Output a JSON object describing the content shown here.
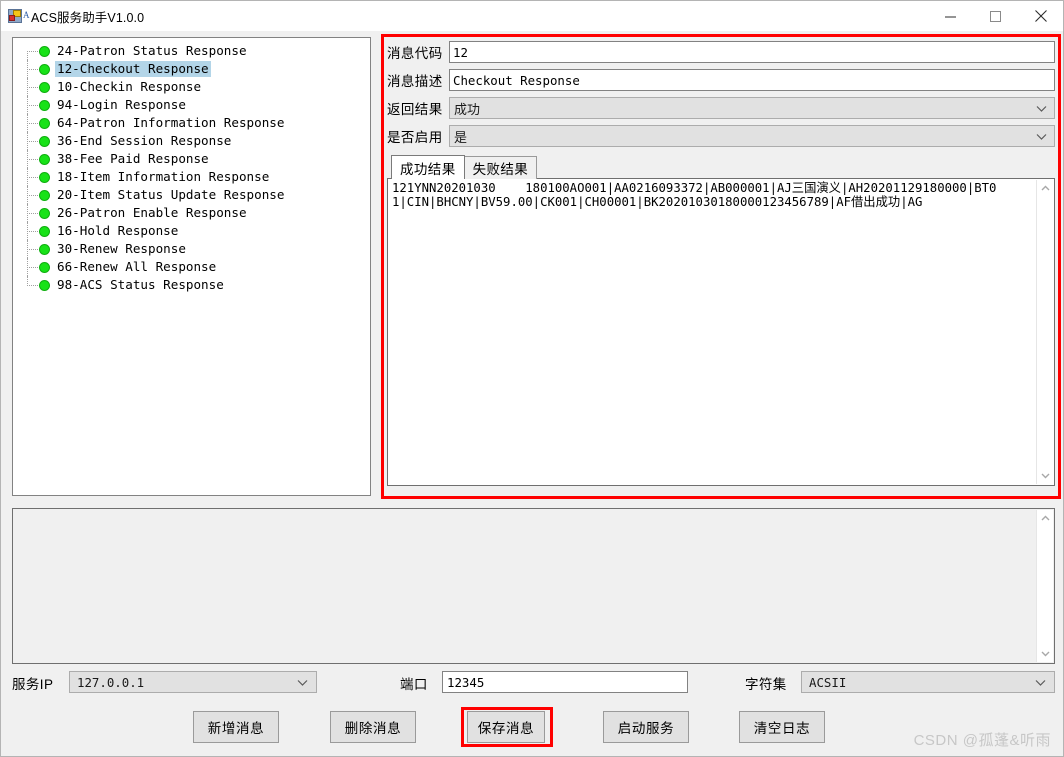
{
  "window": {
    "title": "ACS服务助手V1.0.0",
    "icon": "app-window-icon",
    "minimize": "−",
    "maximize": "□",
    "close": "✕"
  },
  "tree": {
    "items": [
      {
        "label": "24-Patron Status Response",
        "selected": false
      },
      {
        "label": "12-Checkout Response",
        "selected": true
      },
      {
        "label": "10-Checkin Response",
        "selected": false
      },
      {
        "label": "94-Login Response",
        "selected": false
      },
      {
        "label": "64-Patron Information Response",
        "selected": false
      },
      {
        "label": "36-End Session Response",
        "selected": false
      },
      {
        "label": "38-Fee Paid Response",
        "selected": false
      },
      {
        "label": "18-Item Information Response",
        "selected": false
      },
      {
        "label": "20-Item Status Update Response",
        "selected": false
      },
      {
        "label": "26-Patron Enable Response",
        "selected": false
      },
      {
        "label": "16-Hold Response",
        "selected": false
      },
      {
        "label": "30-Renew Response",
        "selected": false
      },
      {
        "label": "66-Renew All Response",
        "selected": false
      },
      {
        "label": "98-ACS Status Response",
        "selected": false
      }
    ]
  },
  "form": {
    "code": {
      "label": "消息代码",
      "value": "12"
    },
    "desc": {
      "label": "消息描述",
      "value": "Checkout Response"
    },
    "result": {
      "label": "返回结果",
      "value": "成功"
    },
    "enabled": {
      "label": "是否启用",
      "value": "是"
    },
    "tabs": [
      {
        "label": "成功结果",
        "active": true
      },
      {
        "label": "失败结果",
        "active": false
      }
    ],
    "result_text": "121YNN20201030    180100AO001|AA0216093372|AB000001|AJ三国演义|AH20201129180000|BT01|CIN|BHCNY|BV59.00|CK001|CH00001|BK20201030180000123456789|AF借出成功|AG"
  },
  "bottom": {
    "server_ip": {
      "label": "服务IP",
      "value": "127.0.0.1"
    },
    "port": {
      "label": "端口",
      "value": "12345"
    },
    "charset": {
      "label": "字符集",
      "value": "ACSII"
    }
  },
  "buttons": {
    "add": "新增消息",
    "delete": "删除消息",
    "save": "保存消息",
    "start": "启动服务",
    "clear": "清空日志"
  },
  "watermark": "CSDN @孤蓬&听雨",
  "colors": {
    "highlight_red": "#ff0000",
    "selection_blue": "#b3d5e8",
    "bullet_green": "#18e218"
  }
}
